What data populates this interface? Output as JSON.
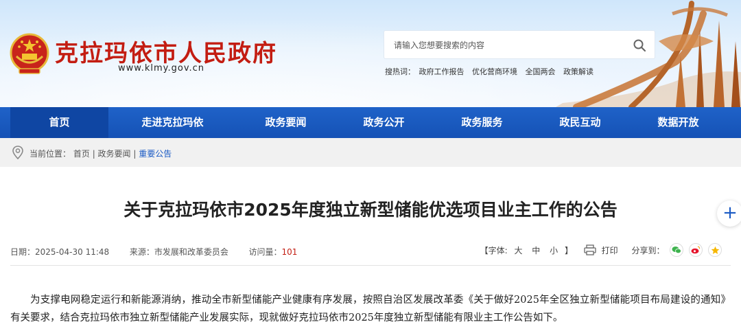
{
  "header": {
    "site_title": "克拉玛依市人民政府",
    "site_url": "www.klmy.gov.cn",
    "search_placeholder": "请输入您想要搜索的内容",
    "hot_label": "搜热词：",
    "hot_words": [
      "政府工作报告",
      "优化营商环境",
      "全国两会",
      "政策解读"
    ]
  },
  "nav": {
    "items": [
      "首页",
      "走进克拉玛依",
      "政务要闻",
      "政务公开",
      "政务服务",
      "政民互动",
      "数据开放"
    ],
    "active_index": 0
  },
  "breadcrumb": {
    "label": "当前位置：",
    "items": [
      "首页",
      "政务要闻",
      "重要公告"
    ]
  },
  "article": {
    "title": "关于克拉玛依市2025年度独立新型储能优选项目业主工作的公告",
    "date_label": "日期：",
    "date": "2025-04-30 11:48",
    "source_label": "来源：",
    "source": "市发展和改革委员会",
    "views_label": "访问量：",
    "views": "101",
    "font_label_open": "【字体:",
    "font_large": "大",
    "font_medium": "中",
    "font_small": "小",
    "font_label_close": "】",
    "print_label": "打印",
    "share_label": "分享到：",
    "body": "为支撑电网稳定运行和新能源消纳，推动全市新型储能产业健康有序发展，按照自治区发展改革委《关于做好2025年全区独立新型储能项目布局建设的通知》有关要求，结合克拉玛依市独立新型储能产业发展实际，现就做好克拉玛依市2025年度独立新型储能有限业主工作公告如下。"
  },
  "floating": {
    "plus": "+"
  },
  "colors": {
    "brand_red": "#c31d12",
    "nav_blue": "#1a5ac4",
    "nav_active": "#0f46a3"
  }
}
